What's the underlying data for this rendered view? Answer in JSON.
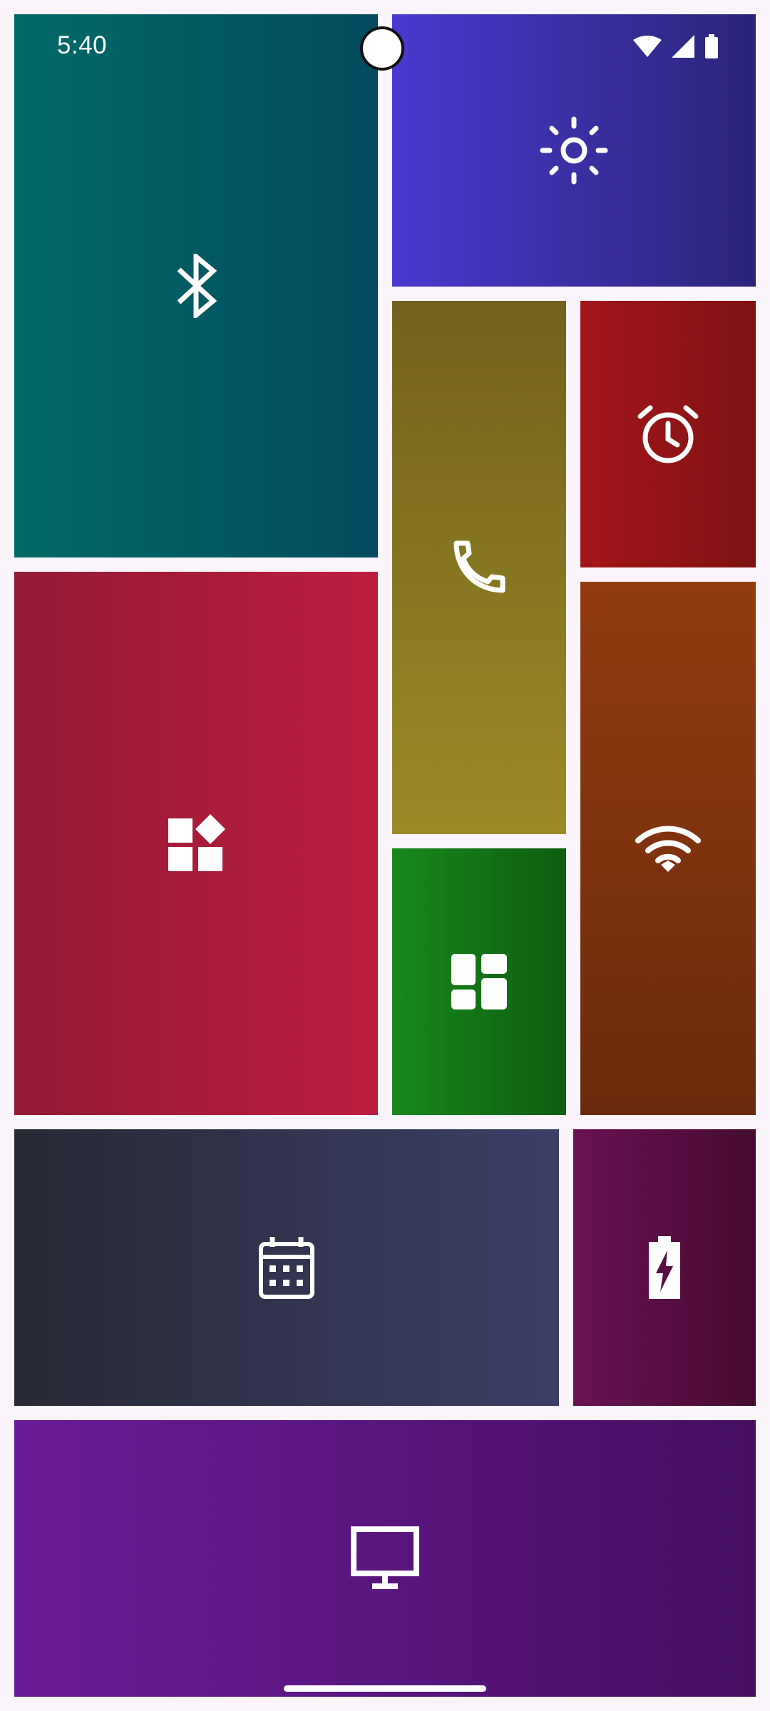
{
  "status_bar": {
    "time": "5:40"
  },
  "tiles": {
    "bluetooth": {
      "icon": "bluetooth-icon",
      "colors": [
        "#026a67",
        "#034a5e"
      ]
    },
    "brightness": {
      "icon": "brightness-icon",
      "colors": [
        "#4a3ad0",
        "#2b2478"
      ]
    },
    "phone": {
      "icon": "phone-icon",
      "colors": [
        "#72621c",
        "#9c8a26"
      ]
    },
    "alarm": {
      "icon": "alarm-icon",
      "colors": [
        "#a3161a",
        "#7f1212"
      ]
    },
    "apps": {
      "icon": "apps-icon",
      "colors": [
        "#911b35",
        "#be1e3f"
      ]
    },
    "widgets": {
      "icon": "widgets-icon",
      "colors": [
        "#17881c",
        "#0f5d12"
      ]
    },
    "wifi": {
      "icon": "wifi-icon",
      "colors": [
        "#923c10",
        "#6a2a0d"
      ]
    },
    "calendar": {
      "icon": "calendar-icon",
      "colors": [
        "#282a36",
        "#3c3e68"
      ]
    },
    "battery": {
      "icon": "battery-charging-icon",
      "colors": [
        "#6a1255",
        "#460b30"
      ]
    },
    "display": {
      "icon": "display-icon",
      "colors": [
        "#6a1c98",
        "#470f62"
      ]
    }
  }
}
